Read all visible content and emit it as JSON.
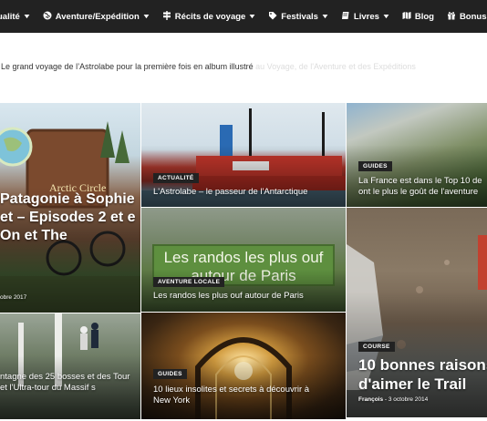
{
  "nav": {
    "items": [
      {
        "label": "ualité",
        "icon": "",
        "dropdown": true
      },
      {
        "label": "Aventure/Expédition",
        "icon": "globe-icon",
        "dropdown": true
      },
      {
        "label": "Récits de voyage",
        "icon": "signpost-icon",
        "dropdown": true
      },
      {
        "label": "Festivals",
        "icon": "tag-icon",
        "dropdown": true
      },
      {
        "label": "Livres",
        "icon": "book-icon",
        "dropdown": true
      },
      {
        "label": "Blog",
        "icon": "map-icon",
        "dropdown": false
      },
      {
        "label": "Bonus",
        "icon": "gift-icon",
        "dropdown": true
      }
    ]
  },
  "ticker": {
    "headline": "Le grand voyage de l’Astrolabe pour la première fois en album illustré",
    "faded": "au Voyage, de l'Aventure et des Expéditions"
  },
  "tiles": {
    "patagonie": {
      "sign_text": "Arctic Circle",
      "title": "Patagonie à Sophie et – Episodes 2 et e On et The",
      "date": "obre 2017"
    },
    "astrolabe": {
      "badge": "ACTUALITÉ",
      "title": "L'Astrolabe – le passeur de l'Antarctique"
    },
    "france": {
      "badge": "GUIDES",
      "title": "La France est dans le Top 10 de ont le plus le goût de l'aventure"
    },
    "randos": {
      "sign_text": "Les randos les plus ouf autour de Paris",
      "badge": "AVENTURE LOCALE",
      "title": "Les randos les plus ouf autour de Paris"
    },
    "trail": {
      "badge": "COURSE",
      "title": "10 bonnes raisons d'aimer le Trail",
      "author": "François",
      "date": "3 octobre 2014"
    },
    "bosses": {
      "title": "ntagne des 25 bosses et des Tour et l'Ultra-tour du Massif s"
    },
    "insolites": {
      "badge": "GUIDES",
      "title": "10 lieux insolites et secrets à découvrir à New York"
    }
  },
  "colors": {
    "nav_bg": "#222222",
    "badge_bg": "#222222"
  }
}
